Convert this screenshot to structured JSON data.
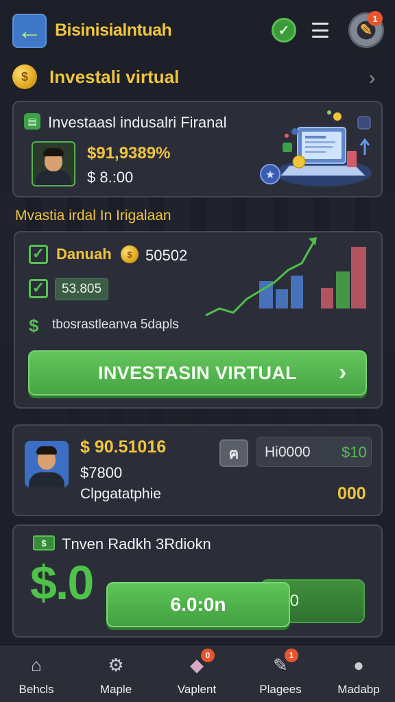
{
  "header": {
    "title": "Bisinisialntuah",
    "back_icon": "arrow-left-icon",
    "verify_icon": "check-badge-icon",
    "menu_icon": "hamburger-menu-icon",
    "settings_icon": "gear-icon",
    "settings_badge": "1",
    "colors": {
      "accent": "#f0c53a",
      "back_button": "#3f78c9"
    }
  },
  "section1": {
    "title": "Investali virtual",
    "coin_symbol": "$",
    "chevron_icon": "chevron-right-icon"
  },
  "card1": {
    "title": "Investaasl indusalri Firanal",
    "amount_primary": "$91,9389%",
    "amount_secondary": "$ 8.:00"
  },
  "section2": {
    "title": "Mvastia irdal In Irigalaan"
  },
  "card2": {
    "label1": "Danuah",
    "coin_symbol": "$",
    "value1": "50502",
    "pill_value": "53.805",
    "dollar_symbol": "$",
    "description": "tbosrastleanva 5dapls",
    "button_label": "INVESTASIN VIRTUAL",
    "button_chevron": "›"
  },
  "card3": {
    "amount1": "$ 90.51016",
    "amount2": "$7800",
    "category": "Clpgatatphie",
    "small_icon_glyph": "ฅ",
    "box_label": "Hi0000",
    "box_value": "$10",
    "bottom_value": "000"
  },
  "card4": {
    "icon_glyph": "$",
    "title": "Tnven Radkh 3Rdiokn",
    "big_amount": "$.0",
    "back_button_label": "0",
    "button_label": "6.0:0n"
  },
  "bottom_nav": {
    "items": [
      {
        "label": "Behcls",
        "icon": "home-icon",
        "glyph": "⌂",
        "badge": ""
      },
      {
        "label": "Maple",
        "icon": "gear-face-icon",
        "glyph": "⚙",
        "badge": ""
      },
      {
        "label": "Vaplent",
        "icon": "gift-box-icon",
        "glyph": "◆",
        "badge": "0"
      },
      {
        "label": "Plagees",
        "icon": "edit-icon",
        "glyph": "✎",
        "badge": "1"
      },
      {
        "label": "Madabp",
        "icon": "user-icon",
        "glyph": "●",
        "badge": ""
      }
    ]
  }
}
